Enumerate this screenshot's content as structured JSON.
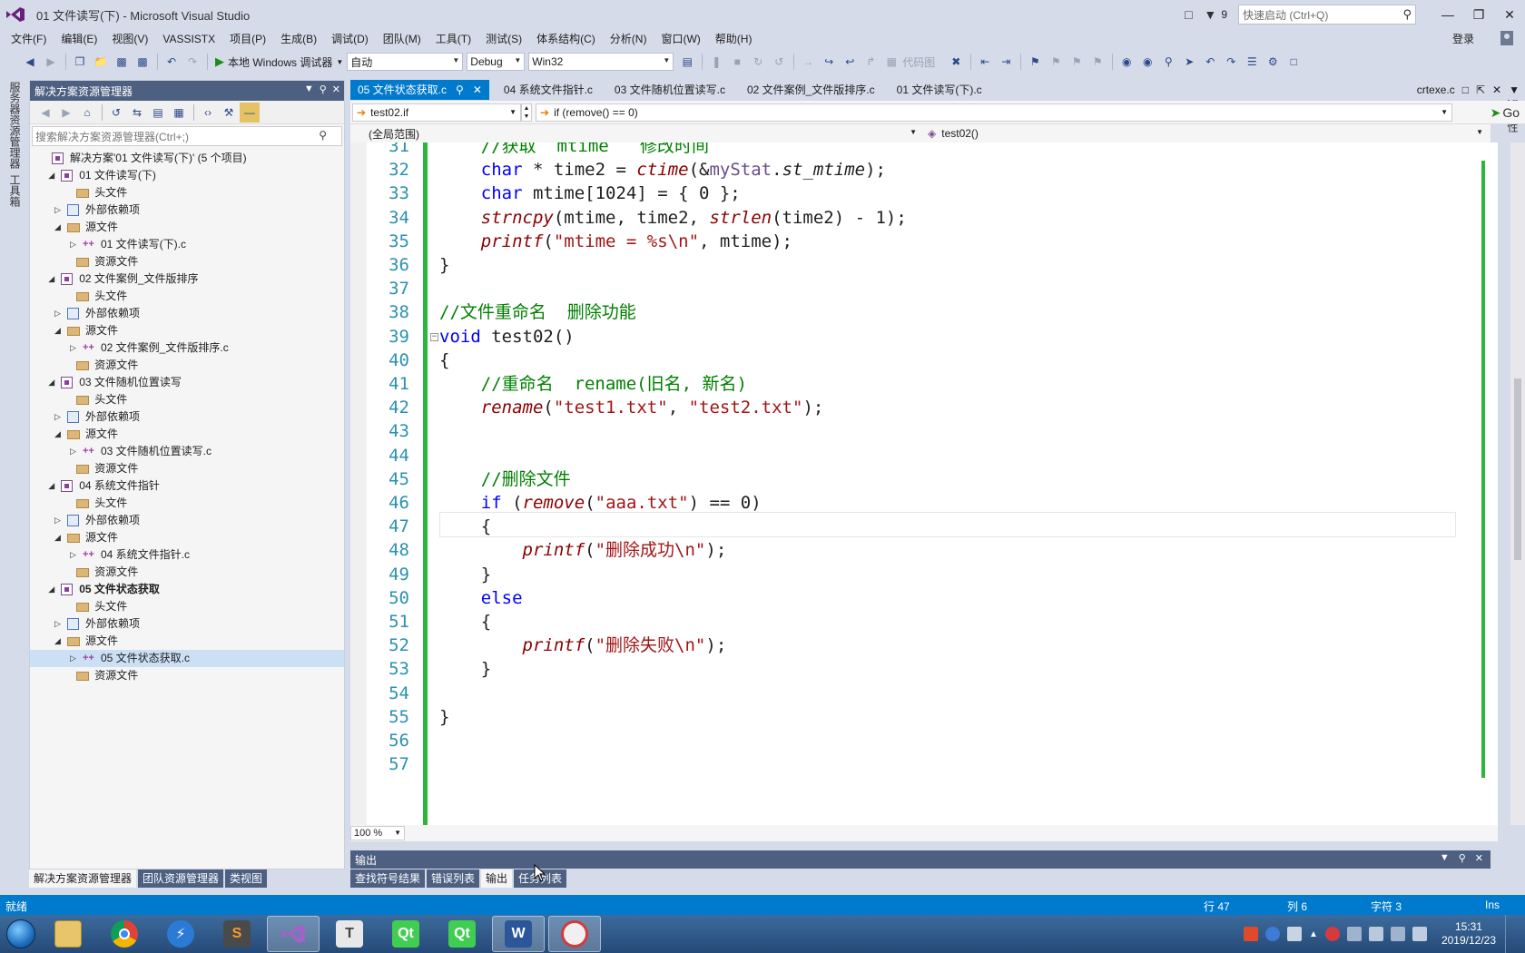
{
  "window": {
    "title": "01 文件读写(下) - Microsoft Visual Studio",
    "notification_count": "9",
    "quick_launch_placeholder": "快速启动 (Ctrl+Q)",
    "login": "登录"
  },
  "menu": [
    "文件(F)",
    "编辑(E)",
    "视图(V)",
    "VASSISTX",
    "项目(P)",
    "生成(B)",
    "调试(D)",
    "团队(M)",
    "工具(T)",
    "测试(S)",
    "体系结构(C)",
    "分析(N)",
    "窗口(W)",
    "帮助(H)"
  ],
  "toolbar": {
    "debugger_label": "本地 Windows 调试器",
    "auto_combo": "自动",
    "config_combo": "Debug",
    "platform_combo": "Win32",
    "code_map_label": "代码图"
  },
  "left_strip": {
    "tab1": "服务器资源管理器",
    "tab2": "工具箱"
  },
  "right_strip": {
    "tab1": "通知",
    "tab2": "属性"
  },
  "solution_explorer": {
    "title": "解决方案资源管理器",
    "search_placeholder": "搜索解决方案资源管理器(Ctrl+;)",
    "solution_label": "解决方案'01 文件读写(下)' (5 个项目)",
    "projects": [
      {
        "name": "01 文件读写(下)",
        "bold": false,
        "headers": "头文件",
        "external": "外部依赖项",
        "sources": "源文件",
        "source_file": "01 文件读写(下).c",
        "resources": "资源文件"
      },
      {
        "name": "02 文件案例_文件版排序",
        "bold": false,
        "headers": "头文件",
        "external": "外部依赖项",
        "sources": "源文件",
        "source_file": "02 文件案例_文件版排序.c",
        "resources": "资源文件"
      },
      {
        "name": "03 文件随机位置读写",
        "bold": false,
        "headers": "头文件",
        "external": "外部依赖项",
        "sources": "源文件",
        "source_file": "03 文件随机位置读写.c",
        "resources": "资源文件"
      },
      {
        "name": "04 系统文件指针",
        "bold": false,
        "headers": "头文件",
        "external": "外部依赖项",
        "sources": "源文件",
        "source_file": "04 系统文件指针.c",
        "resources": "资源文件"
      },
      {
        "name": "05 文件状态获取",
        "bold": true,
        "headers": "头文件",
        "external": "外部依赖项",
        "sources": "源文件",
        "source_file": "05 文件状态获取.c",
        "resources": "资源文件"
      }
    ],
    "bottom_tabs": [
      "解决方案资源管理器",
      "团队资源管理器",
      "类视图"
    ]
  },
  "doc_tabs": {
    "tabs": [
      "05 文件状态获取.c",
      "04 系统文件指针.c",
      "03 文件随机位置读写.c",
      "02 文件案例_文件版排序.c",
      "01 文件读写(下).c"
    ],
    "right_file": "crtexe.c"
  },
  "navigation": {
    "scope_left": "test02.if",
    "scope_middle": "if (remove() == 0)",
    "project_scope": "(全局范围)",
    "function_scope": "test02()",
    "go_label": "Go"
  },
  "editor": {
    "zoom": "100 %",
    "current_line": 47,
    "lines": [
      {
        "n": "31",
        "text": "    //获取  mtime   修改时间"
      },
      {
        "n": "32",
        "text": "    char * time2 = ctime(&myStat.st_mtime);"
      },
      {
        "n": "33",
        "text": "    char mtime[1024] = { 0 };"
      },
      {
        "n": "34",
        "text": "    strncpy(mtime, time2, strlen(time2) - 1);"
      },
      {
        "n": "35",
        "text": "    printf(\"mtime = %s\\n\", mtime);"
      },
      {
        "n": "36",
        "text": "}"
      },
      {
        "n": "37",
        "text": ""
      },
      {
        "n": "38",
        "text": "//文件重命名  删除功能"
      },
      {
        "n": "39",
        "text": "void test02()"
      },
      {
        "n": "40",
        "text": "{"
      },
      {
        "n": "41",
        "text": "    //重命名  rename(旧名, 新名)"
      },
      {
        "n": "42",
        "text": "    rename(\"test1.txt\", \"test2.txt\");"
      },
      {
        "n": "43",
        "text": ""
      },
      {
        "n": "44",
        "text": ""
      },
      {
        "n": "45",
        "text": "    //删除文件"
      },
      {
        "n": "46",
        "text": "    if (remove(\"aaa.txt\") == 0)"
      },
      {
        "n": "47",
        "text": "    {"
      },
      {
        "n": "48",
        "text": "        printf(\"删除成功\\n\");"
      },
      {
        "n": "49",
        "text": "    }"
      },
      {
        "n": "50",
        "text": "    else"
      },
      {
        "n": "51",
        "text": "    {"
      },
      {
        "n": "52",
        "text": "        printf(\"删除失败\\n\");"
      },
      {
        "n": "53",
        "text": "    }"
      },
      {
        "n": "54",
        "text": ""
      },
      {
        "n": "55",
        "text": "}"
      },
      {
        "n": "56",
        "text": ""
      },
      {
        "n": "57",
        "text": ""
      }
    ]
  },
  "output": {
    "title": "输出",
    "tabs": [
      "查找符号结果",
      "错误列表",
      "输出",
      "任务列表"
    ]
  },
  "statusbar": {
    "ready": "就绪",
    "line": "行 47",
    "col": "列 6",
    "char": "字符 3",
    "mode": "Ins"
  },
  "taskbar": {
    "time": "15:31",
    "date": "2019/12/23"
  },
  "colors": {
    "accent": "#007acc",
    "panel_header": "#4d6082",
    "chrome": "#d6dbe9",
    "comment": "#008000",
    "keyword": "#0000ff",
    "string": "#a31515",
    "line_number": "#2b91af"
  }
}
